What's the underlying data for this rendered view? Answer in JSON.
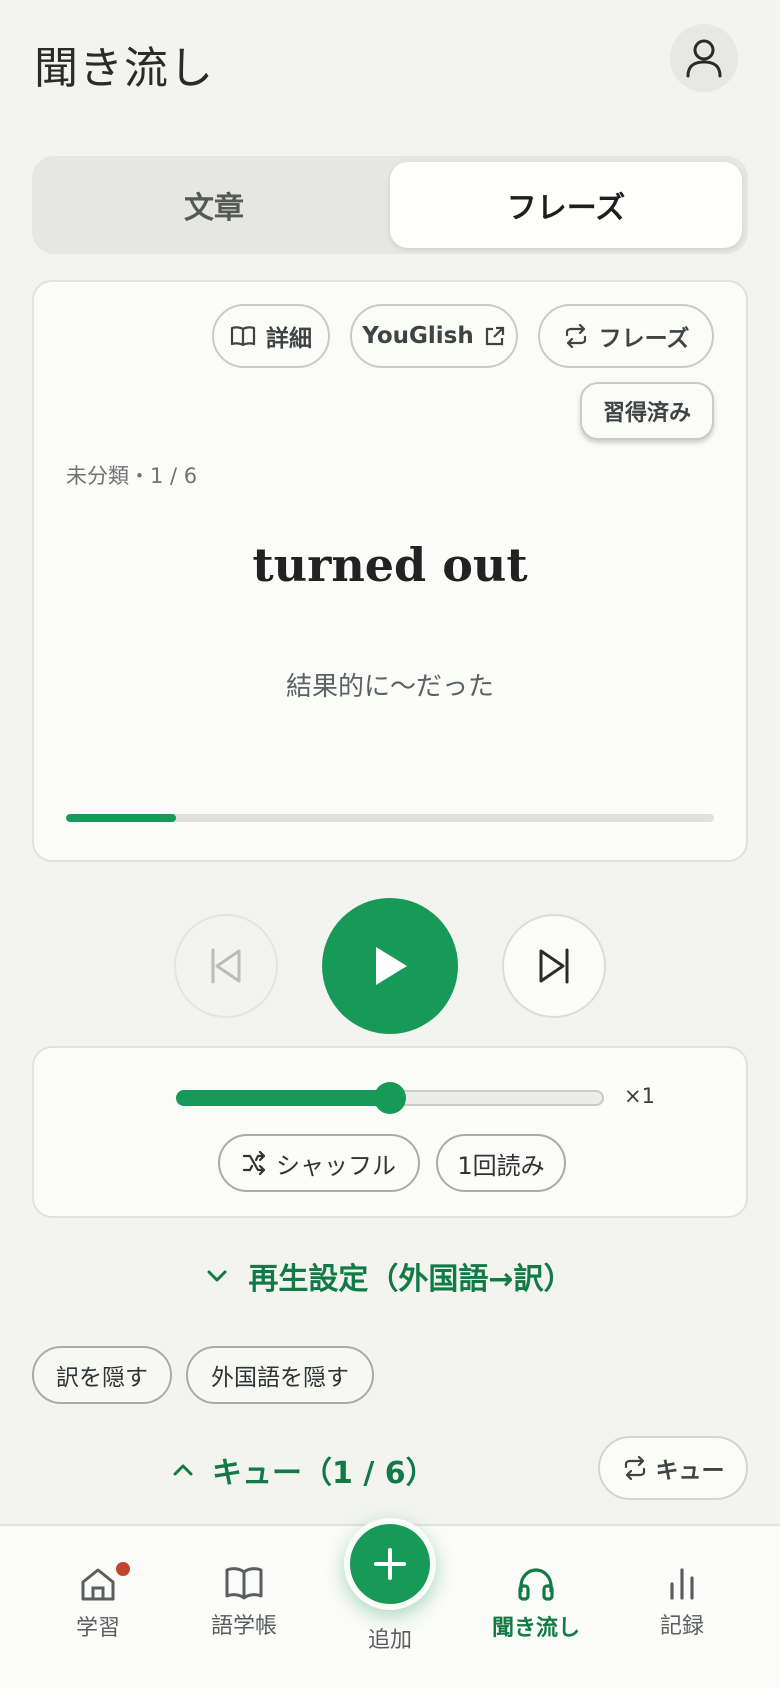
{
  "header": {
    "title": "聞き流し",
    "profile_icon": "user-icon"
  },
  "mode_tabs": [
    {
      "label": "文章",
      "active": false
    },
    {
      "label": "フレーズ",
      "active": true
    }
  ],
  "card": {
    "actions": {
      "detail": "詳細",
      "youglish": "YouGlish",
      "phrase_loop": "フレーズ",
      "mastered": "習得済み"
    },
    "meta": "未分類・1 / 6",
    "phrase": "turned out",
    "translation": "結果的に〜だった",
    "progress": 0.17
  },
  "controls": {
    "prev_icon": "skip-back-icon",
    "play_icon": "play-icon",
    "next_icon": "skip-forward-icon"
  },
  "settings": {
    "speed_level": 0.5,
    "speed_label": "×1",
    "shuffle_label": "シャッフル",
    "read_once_label": "1回読み"
  },
  "playback_settings_label": "再生設定（外国語→訳）",
  "hide_buttons": {
    "hide_translation": "訳を隠す",
    "hide_foreign": "外国語を隠す"
  },
  "queue": {
    "label": "キュー（1 / 6）",
    "repeat_label": "キュー"
  },
  "colors": {
    "accent": "#179a57",
    "accent_dark": "#127a44",
    "badge": "#c2452f"
  },
  "nav": {
    "home": "学習",
    "vocab": "語学帳",
    "add": "追加",
    "listen": "聞き流し",
    "stats": "記録"
  }
}
